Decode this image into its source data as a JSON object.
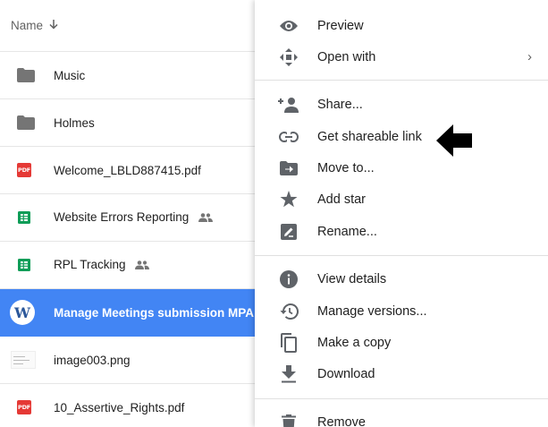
{
  "file_list": {
    "header": {
      "name_label": "Name",
      "sort_icon": "arrow-down-icon"
    },
    "rows": [
      {
        "name": "Music",
        "icon": "folder-icon"
      },
      {
        "name": "Holmes",
        "icon": "folder-icon"
      },
      {
        "name": "Welcome_LBLD887415.pdf",
        "icon": "pdf-icon",
        "badge": "PDF"
      },
      {
        "name": "Website Errors Reporting",
        "icon": "sheets-icon",
        "shared": true
      },
      {
        "name": "RPL Tracking",
        "icon": "sheets-icon",
        "shared": true
      },
      {
        "name": "Manage Meetings submission MPA",
        "icon": "word-icon",
        "badge": "W",
        "selected": true
      },
      {
        "name": "image003.png",
        "icon": "image-thumbnail"
      },
      {
        "name": "10_Assertive_Rights.pdf",
        "icon": "pdf-icon",
        "badge": "PDF"
      }
    ]
  },
  "context_menu": {
    "items": [
      {
        "label": "Preview",
        "icon": "eye-icon"
      },
      {
        "label": "Open with",
        "icon": "open-with-icon",
        "submenu": "›"
      },
      {
        "label": "Share...",
        "icon": "add-person-icon"
      },
      {
        "label": "Get shareable link",
        "icon": "link-icon"
      },
      {
        "label": "Move to...",
        "icon": "move-to-folder-icon"
      },
      {
        "label": "Add star",
        "icon": "star-icon"
      },
      {
        "label": "Rename...",
        "icon": "rename-icon"
      },
      {
        "label": "View details",
        "icon": "info-icon"
      },
      {
        "label": "Manage versions...",
        "icon": "history-icon"
      },
      {
        "label": "Make a copy",
        "icon": "copy-icon"
      },
      {
        "label": "Download",
        "icon": "download-icon"
      },
      {
        "label": "Remove",
        "icon": "trash-icon"
      }
    ]
  },
  "annotation": {
    "icon": "left-arrow-pointer-icon"
  },
  "colors": {
    "selected_row": "#4285f4",
    "pdf_red": "#e53935",
    "sheets_green": "#0f9d58",
    "icon_grey": "#5f6368"
  }
}
